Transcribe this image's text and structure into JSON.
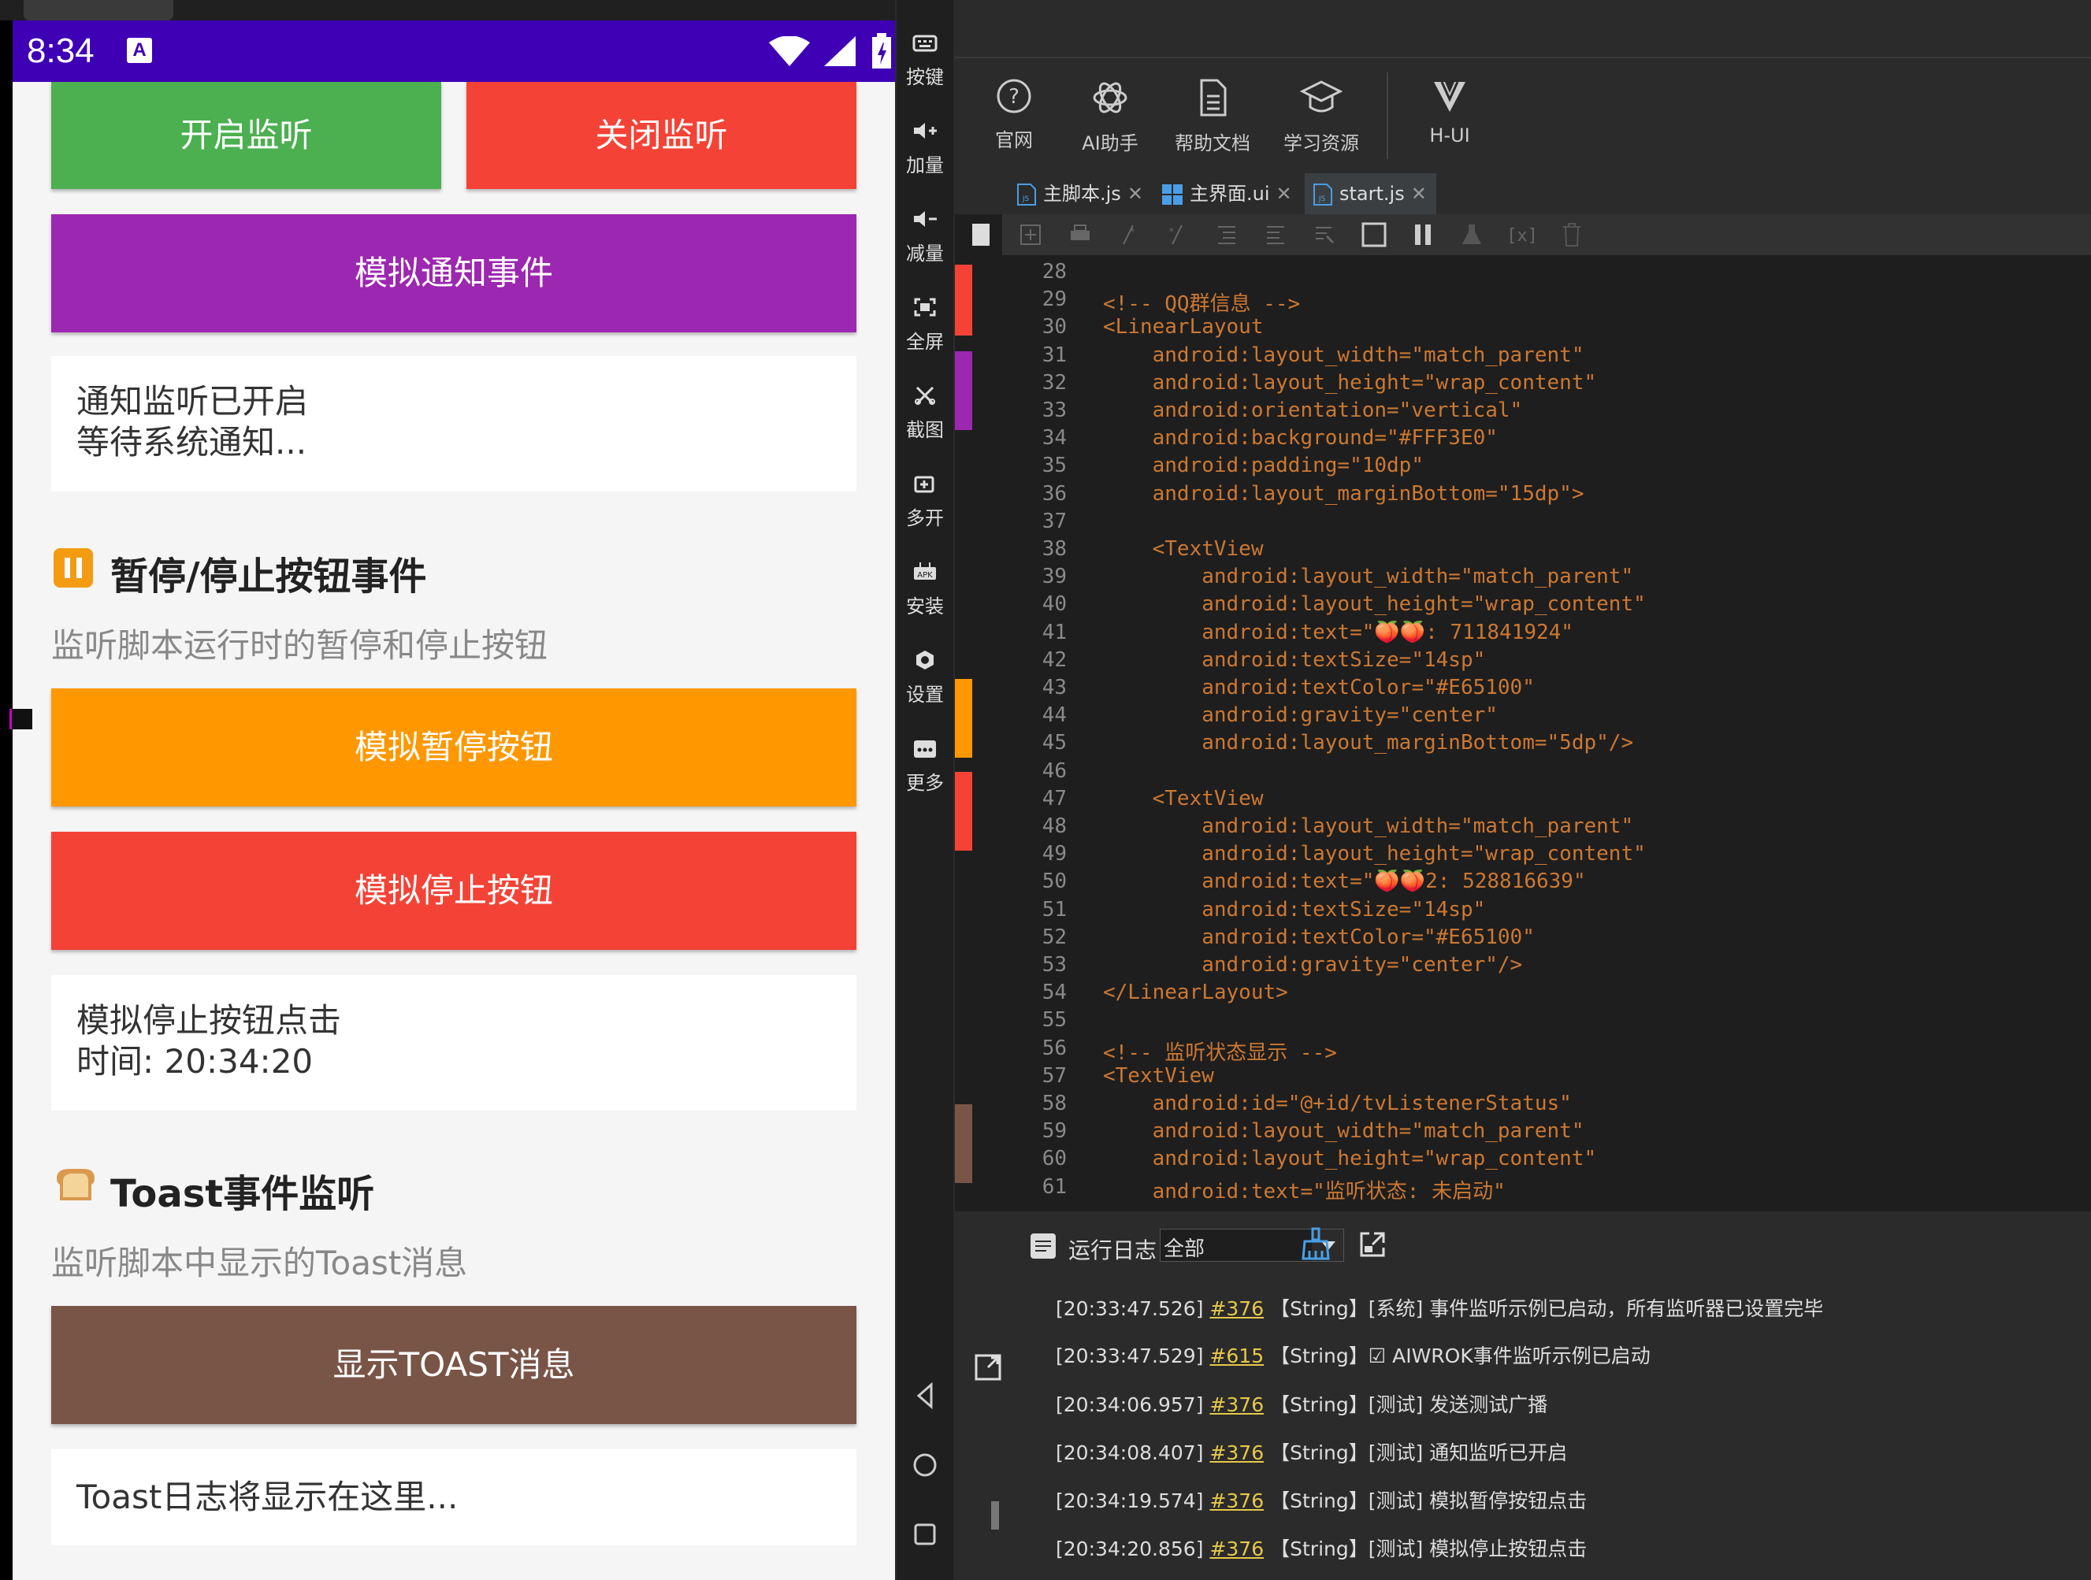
{
  "statusbar": {
    "time": "8:34",
    "a_icon": "A"
  },
  "app": {
    "btn_start": "开启监听",
    "btn_stop": "关闭监听",
    "btn_notify": "模拟通知事件",
    "notify_status_line1": "通知监听已开启",
    "notify_status_line2": "等待系统通知...",
    "section_pause_title": "暂停/停止按钮事件",
    "section_pause_sub": "监听脚本运行时的暂停和停止按钮",
    "btn_pause": "模拟暂停按钮",
    "btn_stop_sim": "模拟停止按钮",
    "stop_status_line1": "模拟停止按钮点击",
    "stop_status_line2": "时间: 20:34:20",
    "section_toast_title": "Toast事件监听",
    "section_toast_sub": "监听脚本中显示的Toast消息",
    "btn_toast": "显示TOAST消息",
    "toast_log": "Toast日志将显示在这里..."
  },
  "emulator_toolbar": {
    "items": [
      {
        "icon": "keyboard-icon",
        "label": "按键"
      },
      {
        "icon": "volume-up-icon",
        "label": "加量"
      },
      {
        "icon": "volume-down-icon",
        "label": "减量"
      },
      {
        "icon": "fullscreen-icon",
        "label": "全屏"
      },
      {
        "icon": "scissors-icon",
        "label": "截图"
      },
      {
        "icon": "multi-open-icon",
        "label": "多开"
      },
      {
        "icon": "apk-icon",
        "label": "安装"
      },
      {
        "icon": "settings-icon",
        "label": "设置"
      },
      {
        "icon": "more-icon",
        "label": "更多"
      }
    ]
  },
  "ide": {
    "toolbar": [
      {
        "icon": "help-circle-icon",
        "label": "官网"
      },
      {
        "icon": "ai-openai-icon",
        "label": "AI助手"
      },
      {
        "icon": "document-icon",
        "label": "帮助文档"
      },
      {
        "icon": "graduation-cap-icon",
        "label": "学习资源"
      },
      {
        "icon": "v-logo-icon",
        "label": "H-UI"
      }
    ],
    "tabs": [
      {
        "label": "主脚本.js",
        "close": "✕"
      },
      {
        "label": "主界面.ui",
        "close": "✕"
      },
      {
        "label": "start.js",
        "close": "✕"
      }
    ],
    "code_lines": [
      {
        "n": "28",
        "t": ""
      },
      {
        "n": "29",
        "t": "<!-- QQ群信息 -->"
      },
      {
        "n": "30",
        "t": "<LinearLayout"
      },
      {
        "n": "31",
        "t": "    android:layout_width=\"match_parent\""
      },
      {
        "n": "32",
        "t": "    android:layout_height=\"wrap_content\""
      },
      {
        "n": "33",
        "t": "    android:orientation=\"vertical\""
      },
      {
        "n": "34",
        "t": "    android:background=\"#FFF3E0\""
      },
      {
        "n": "35",
        "t": "    android:padding=\"10dp\""
      },
      {
        "n": "36",
        "t": "    android:layout_marginBottom=\"15dp\">"
      },
      {
        "n": "37",
        "t": ""
      },
      {
        "n": "38",
        "t": "    <TextView"
      },
      {
        "n": "39",
        "t": "        android:layout_width=\"match_parent\""
      },
      {
        "n": "40",
        "t": "        android:layout_height=\"wrap_content\""
      },
      {
        "n": "41",
        "t": "        android:text=\"🍑🍑: 711841924\""
      },
      {
        "n": "42",
        "t": "        android:textSize=\"14sp\""
      },
      {
        "n": "43",
        "t": "        android:textColor=\"#E65100\""
      },
      {
        "n": "44",
        "t": "        android:gravity=\"center\""
      },
      {
        "n": "45",
        "t": "        android:layout_marginBottom=\"5dp\"/>"
      },
      {
        "n": "46",
        "t": ""
      },
      {
        "n": "47",
        "t": "    <TextView"
      },
      {
        "n": "48",
        "t": "        android:layout_width=\"match_parent\""
      },
      {
        "n": "49",
        "t": "        android:layout_height=\"wrap_content\""
      },
      {
        "n": "50",
        "t": "        android:text=\"🍑🍑2: 528816639\""
      },
      {
        "n": "51",
        "t": "        android:textSize=\"14sp\""
      },
      {
        "n": "52",
        "t": "        android:textColor=\"#E65100\""
      },
      {
        "n": "53",
        "t": "        android:gravity=\"center\"/>"
      },
      {
        "n": "54",
        "t": "</LinearLayout>"
      },
      {
        "n": "55",
        "t": ""
      },
      {
        "n": "56",
        "t": "<!-- 监听状态显示 -->"
      },
      {
        "n": "57",
        "t": "<TextView"
      },
      {
        "n": "58",
        "t": "    android:id=\"@+id/tvListenerStatus\""
      },
      {
        "n": "59",
        "t": "    android:layout_width=\"match_parent\""
      },
      {
        "n": "60",
        "t": "    android:layout_height=\"wrap_content\""
      },
      {
        "n": "61",
        "t": "    android:text=\"监听状态: 未启动\""
      }
    ],
    "log": {
      "title": "运行日志",
      "filter": "全部",
      "lines": [
        {
          "time": "[20:33:47.526]",
          "num": "#376",
          "text": "【String】[系统] 事件监听示例已启动，所有监听器已设置完毕"
        },
        {
          "time": "[20:33:47.529]",
          "num": "#615",
          "text": "【String】☑ AIWROK事件监听示例已启动"
        },
        {
          "time": "[20:34:06.957]",
          "num": "#376",
          "text": "【String】[测试] 发送测试广播"
        },
        {
          "time": "[20:34:08.407]",
          "num": "#376",
          "text": "【String】[测试] 通知监听已开启"
        },
        {
          "time": "[20:34:19.574]",
          "num": "#376",
          "text": "【String】[测试] 模拟暂停按钮点击"
        },
        {
          "time": "[20:34:20.856]",
          "num": "#376",
          "text": "【String】[测试] 模拟停止按钮点击"
        }
      ]
    }
  },
  "colors": {
    "status_bar": "#3f00b5",
    "green": "#4caf50",
    "red": "#f44336",
    "purple": "#9c27b0",
    "orange": "#ff9800",
    "brown": "#795548",
    "code": "#cc7832"
  }
}
